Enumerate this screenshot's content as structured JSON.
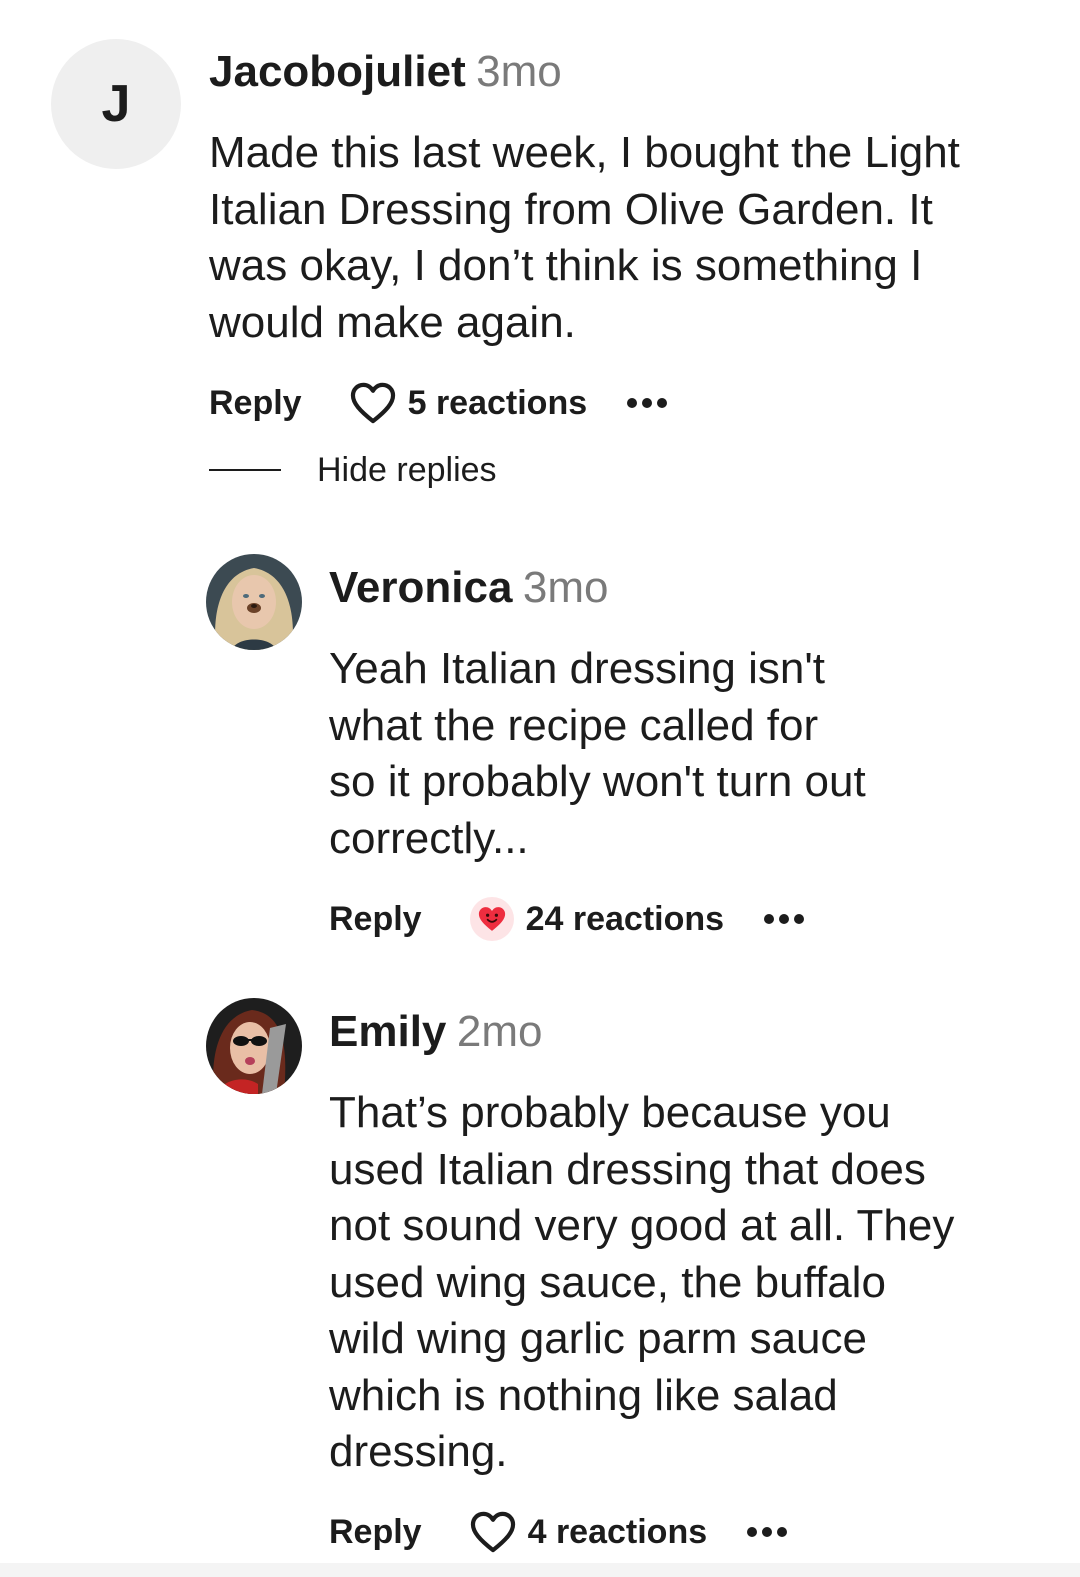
{
  "comments": [
    {
      "author": "Jacobojuliet",
      "avatar_letter": "J",
      "time": "3mo",
      "lines": [
        "Made this last week, I bought the Light",
        "Italian Dressing from Olive Garden. It",
        "was okay, I don’t think is something I",
        "would make again."
      ],
      "reply_label": "Reply",
      "reactions": "5 reactions",
      "reaction_icon": "heart-outline-icon"
    }
  ],
  "hide_replies_label": "Hide replies",
  "replies": [
    {
      "author": "Veronica",
      "time": "3mo",
      "lines": [
        "Yeah Italian dressing isn't",
        "what the recipe called for",
        "so it probably won't turn out",
        "correctly..."
      ],
      "reply_label": "Reply",
      "reactions": "24 reactions",
      "reaction_icon": "love-reaction-icon"
    },
    {
      "author": "Emily",
      "time": "2mo",
      "lines": [
        "That’s probably because you",
        "used Italian dressing that does",
        "not sound very good at all. They",
        "used wing sauce, the buffalo",
        "wild wing garlic parm sauce",
        "which is nothing like salad",
        "dressing."
      ],
      "reply_label": "Reply",
      "reactions": "4 reactions",
      "reaction_icon": "heart-outline-icon"
    }
  ],
  "colors": {
    "text": "#1c1c1c",
    "timestamp": "#7a7a7a",
    "avatar_bg": "#efefef",
    "love_badge_bg": "#fde4e6",
    "love_heart": "#ee2d3f"
  }
}
